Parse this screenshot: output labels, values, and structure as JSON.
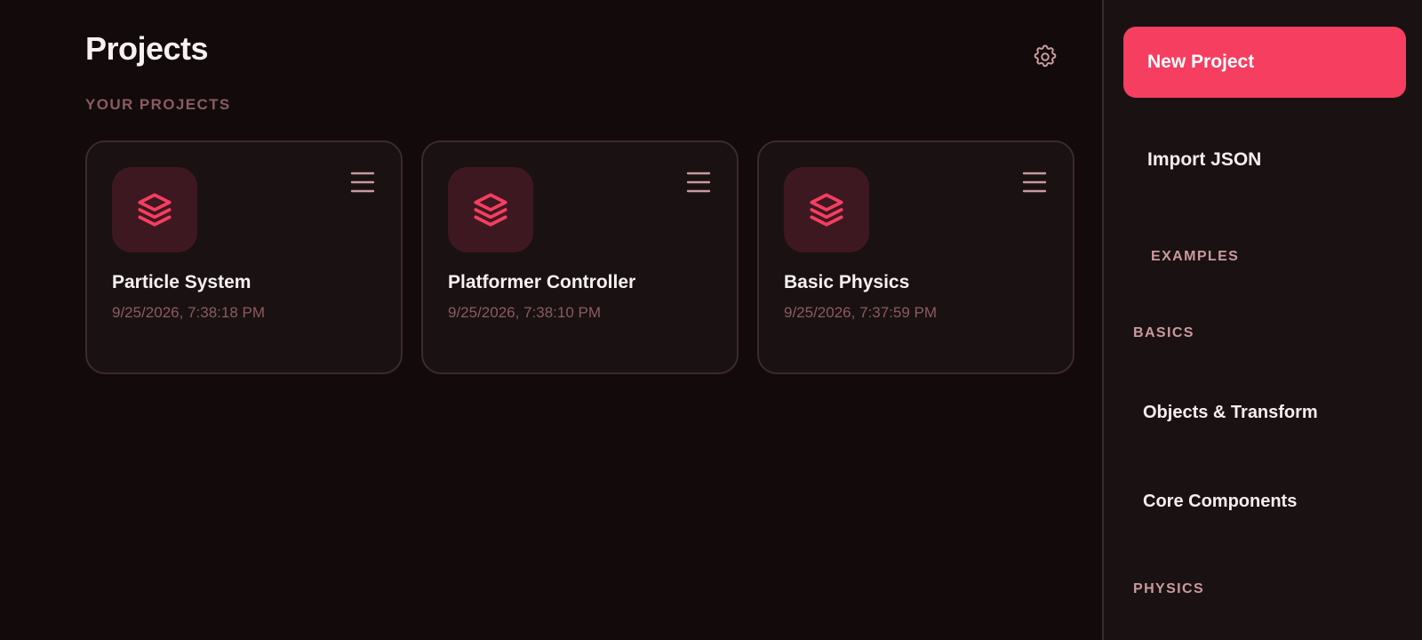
{
  "main": {
    "title": "Projects",
    "section_label": "YOUR PROJECTS",
    "settings_icon": "gear-icon",
    "projects": [
      {
        "name": "Particle System",
        "date": "9/25/2026, 7:38:18 PM",
        "icon": "layers-icon",
        "menu_icon": "hamburger-menu-icon"
      },
      {
        "name": "Platformer Controller",
        "date": "9/25/2026, 7:38:10 PM",
        "icon": "layers-icon",
        "menu_icon": "hamburger-menu-icon"
      },
      {
        "name": "Basic Physics",
        "date": "9/25/2026, 7:37:59 PM",
        "icon": "layers-icon",
        "menu_icon": "hamburger-menu-icon"
      }
    ]
  },
  "sidebar": {
    "new_project_label": "New Project",
    "import_label": "Import JSON",
    "examples_label": "EXAMPLES",
    "basics_label": "BASICS",
    "basics_items": [
      "Objects & Transform",
      "Core Components"
    ],
    "physics_label": "PHYSICS"
  },
  "colors": {
    "accent": "#f53e60",
    "background": "#120a0b",
    "card_background": "#1a1112",
    "muted_text": "#8a5b5f"
  }
}
